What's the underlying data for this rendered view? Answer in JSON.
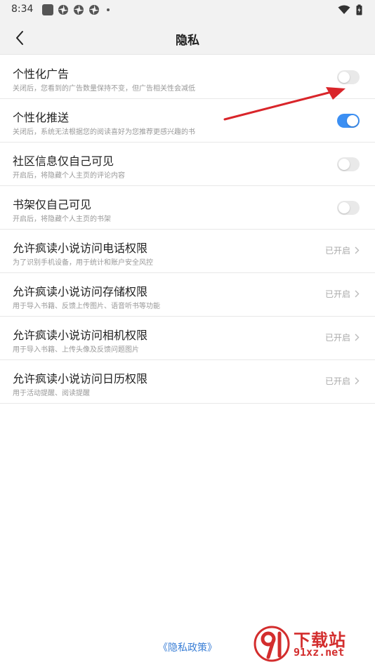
{
  "status_bar": {
    "time": "8:34"
  },
  "header": {
    "title": "隐私"
  },
  "settings": [
    {
      "title": "个性化广告",
      "desc": "关闭后，您看到的广告数量保持不变，但广告相关性会减低",
      "control": "toggle",
      "on": false
    },
    {
      "title": "个性化推送",
      "desc": "关闭后，系统无法根据您的阅读喜好为您推荐更感兴趣的书",
      "control": "toggle",
      "on": true
    },
    {
      "title": "社区信息仅自己可见",
      "desc": "开启后，将隐藏个人主页的评论内容",
      "control": "toggle",
      "on": false
    },
    {
      "title": "书架仅自己可见",
      "desc": "开启后，将隐藏个人主页的书架",
      "control": "toggle",
      "on": false
    },
    {
      "title": "允许疯读小说访问电话权限",
      "desc": "为了识别手机设备，用于统计和账户安全风控",
      "control": "link",
      "status": "已开启"
    },
    {
      "title": "允许疯读小说访问存储权限",
      "desc": "用于导入书籍、反馈上传图片、语音听书等功能",
      "control": "link",
      "status": "已开启"
    },
    {
      "title": "允许疯读小说访问相机权限",
      "desc": "用于导入书籍、上传头像及反馈问题图片",
      "control": "link",
      "status": "已开启"
    },
    {
      "title": "允许疯读小说访问日历权限",
      "desc": "用于活动提醒、阅读提醒",
      "control": "link",
      "status": "已开启"
    }
  ],
  "footer": {
    "policy_link": "《隐私政策》"
  },
  "watermark": {
    "text": "下载站",
    "url": "91xz.net"
  },
  "colors": {
    "accent": "#3b8ff3",
    "annotation_arrow": "#d9252a",
    "link": "#3b7fd6"
  }
}
